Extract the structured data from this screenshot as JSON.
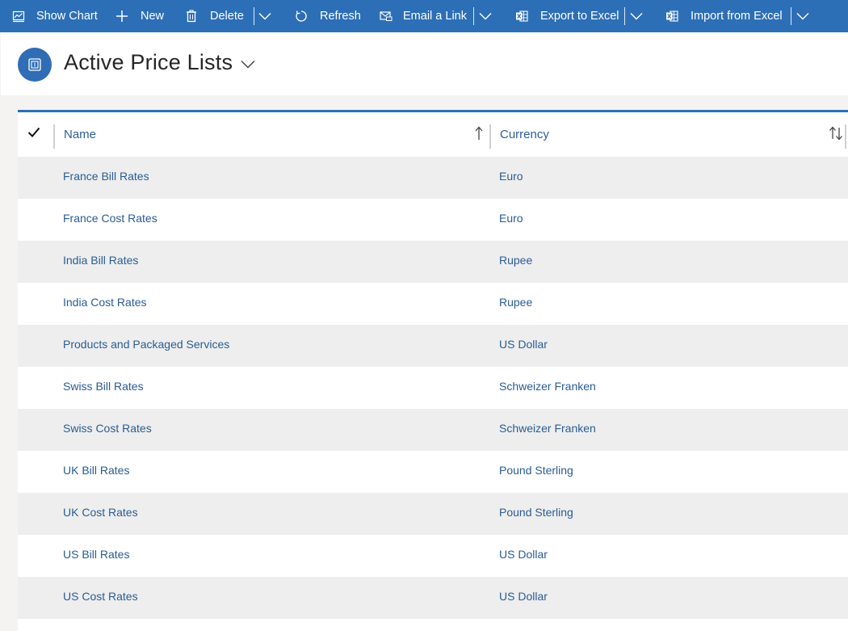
{
  "command_bar": {
    "items": [
      {
        "label": "Show Chart",
        "icon": "chart-icon"
      },
      {
        "label": "New",
        "icon": "plus-icon"
      },
      {
        "label": "Delete",
        "icon": "trash-icon"
      },
      {
        "label": "Refresh",
        "icon": "refresh-icon"
      },
      {
        "label": "Email a Link",
        "icon": "email-link-icon"
      },
      {
        "label": "Export to Excel",
        "icon": "excel-icon"
      },
      {
        "label": "Import from Excel",
        "icon": "excel-icon"
      }
    ]
  },
  "header": {
    "title": "Active Price Lists",
    "entity_icon": "price-list-icon"
  },
  "grid": {
    "columns": [
      {
        "label": "Name",
        "sort": "ascending"
      },
      {
        "label": "Currency",
        "sort": "none"
      }
    ],
    "rows": [
      {
        "name": "France Bill Rates",
        "currency": "Euro"
      },
      {
        "name": "France Cost Rates",
        "currency": "Euro"
      },
      {
        "name": "India Bill Rates",
        "currency": "Rupee"
      },
      {
        "name": "India Cost Rates",
        "currency": "Rupee"
      },
      {
        "name": "Products and Packaged Services",
        "currency": "US Dollar"
      },
      {
        "name": "Swiss Bill Rates",
        "currency": "Schweizer Franken"
      },
      {
        "name": "Swiss Cost Rates",
        "currency": "Schweizer Franken"
      },
      {
        "name": "UK Bill Rates",
        "currency": "Pound Sterling"
      },
      {
        "name": "UK Cost Rates",
        "currency": "Pound Sterling"
      },
      {
        "name": "US Bill Rates",
        "currency": "US Dollar"
      },
      {
        "name": "US Cost Rates",
        "currency": "US Dollar"
      }
    ]
  },
  "colors": {
    "command_bar_bg": "#2d6fb7",
    "link_text": "#2a5c93",
    "row_shade": "#eeeeee"
  }
}
